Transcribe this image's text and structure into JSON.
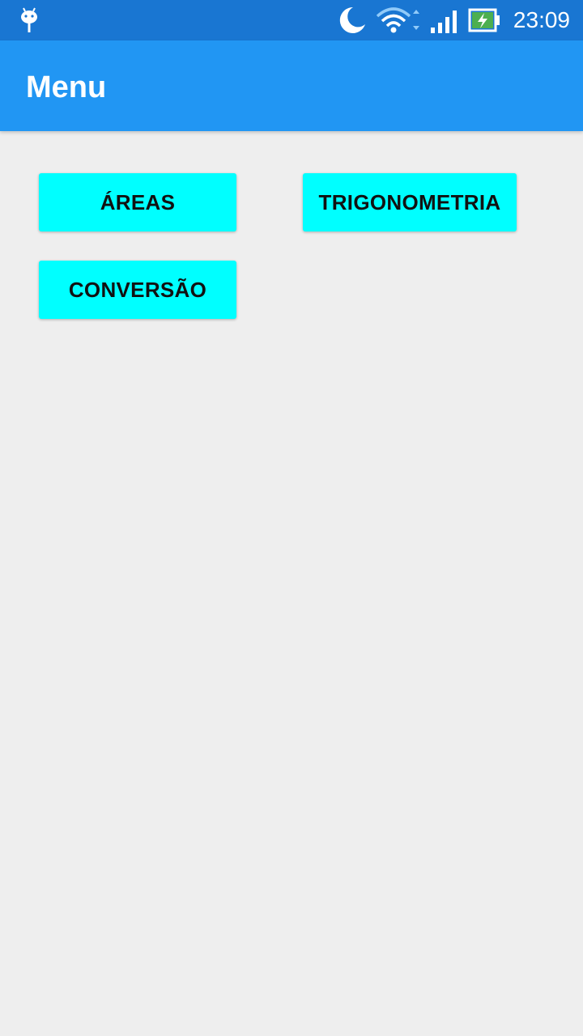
{
  "status_bar": {
    "time": "23:09",
    "icons": [
      "android-icon",
      "moon-icon",
      "wifi-icon",
      "signal-icon",
      "battery-charging-icon"
    ],
    "colors": {
      "background": "#1976d2",
      "battery_fill": "#4caf50"
    }
  },
  "app_bar": {
    "title": "Menu",
    "color": "#2196f3"
  },
  "menu": {
    "button_color": "#00ffff",
    "buttons": [
      {
        "label": "ÁREAS"
      },
      {
        "label": "TRIGONOMETRIA"
      },
      {
        "label": "CONVERSÃO"
      }
    ]
  }
}
